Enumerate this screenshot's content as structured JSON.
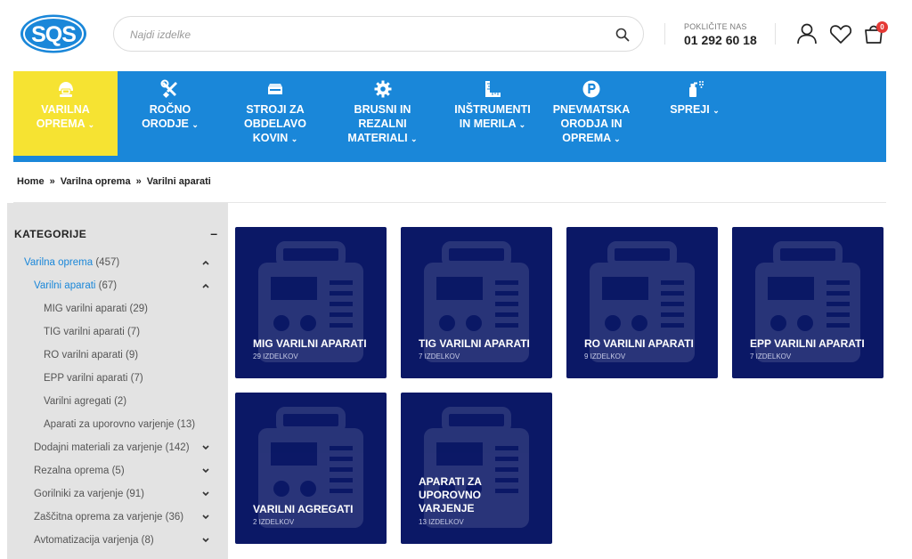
{
  "header": {
    "logo_text": "SQS",
    "search_placeholder": "Najdi izdelke",
    "phone_label": "POKLIČITE NAS",
    "phone_number": "01 292 60 18",
    "cart_count": "0",
    "icons": [
      "search-icon",
      "user-icon",
      "heart-icon",
      "cart-icon"
    ]
  },
  "nav": {
    "items": [
      {
        "label": "VARILNA\nOPREMA",
        "icon": "helmet-icon",
        "active": true
      },
      {
        "label": "ROČNO\nORODJE",
        "icon": "tools-icon",
        "active": false
      },
      {
        "label": "STROJI ZA\nOBDELAVO\nKOVIN",
        "icon": "machine-icon",
        "active": false
      },
      {
        "label": "BRUSNI IN\nREZALNI\nMATERIALI",
        "icon": "gear-icon",
        "active": false
      },
      {
        "label": "INŠTRUMENTI\nIN MERILA",
        "icon": "ruler-icon",
        "active": false
      },
      {
        "label": "PNEVMATSKA\nORODJA IN\nOPREMA",
        "icon": "pneumatic-icon",
        "active": false
      },
      {
        "label": "SPREJI",
        "icon": "spray-icon",
        "active": false
      }
    ],
    "caret": "⌄"
  },
  "breadcrumb": {
    "items": [
      "Home",
      "Varilna oprema",
      "Varilni aparati"
    ],
    "separator": "»"
  },
  "sidebar": {
    "title": "KATEGORIJE",
    "collapse_symbol": "–",
    "categories": [
      {
        "label": "Varilna oprema",
        "count": "(457)",
        "level": 0,
        "expanded": true
      },
      {
        "label": "Varilni aparati",
        "count": "(67)",
        "level": 1,
        "expanded": true
      },
      {
        "label": "MIG varilni aparati",
        "count": "(29)",
        "level": 2
      },
      {
        "label": "TIG varilni aparati",
        "count": "(7)",
        "level": 2
      },
      {
        "label": "RO varilni aparati",
        "count": "(9)",
        "level": 2
      },
      {
        "label": "EPP varilni aparati",
        "count": "(7)",
        "level": 2
      },
      {
        "label": "Varilni agregati",
        "count": "(2)",
        "level": 2
      },
      {
        "label": "Aparati za uporovno varjenje",
        "count": "(13)",
        "level": 2
      },
      {
        "label": "Dodajni materiali za varjenje",
        "count": "(142)",
        "level": 1,
        "expanded": false
      },
      {
        "label": "Rezalna oprema",
        "count": "(5)",
        "level": 1,
        "expanded": false
      },
      {
        "label": "Gorilniki za varjenje",
        "count": "(91)",
        "level": 1,
        "expanded": false
      },
      {
        "label": "Zaščitna oprema za varjenje",
        "count": "(36)",
        "level": 1,
        "expanded": false
      },
      {
        "label": "Avtomatizacija varjenja",
        "count": "(8)",
        "level": 1,
        "expanded": false
      }
    ]
  },
  "tiles": [
    {
      "name": "MIG VARILNI APARATI",
      "count": "29 IZDELKOV"
    },
    {
      "name": "TIG VARILNI APARATI",
      "count": "7 IZDELKOV"
    },
    {
      "name": "RO VARILNI APARATI",
      "count": "9 IZDELKOV"
    },
    {
      "name": "EPP VARILNI APARATI",
      "count": "7 IZDELKOV"
    },
    {
      "name": "VARILNI AGREGATI",
      "count": "2 IZDELKOV"
    },
    {
      "name": "APARATI ZA\nUPOROVNO\nVARJENJE",
      "count": "13 IZDELKOV"
    }
  ],
  "colors": {
    "brand_blue": "#1a87d9",
    "active_yellow": "#f6e332",
    "tile_navy": "#0b1866",
    "badge_red": "#e53935"
  }
}
